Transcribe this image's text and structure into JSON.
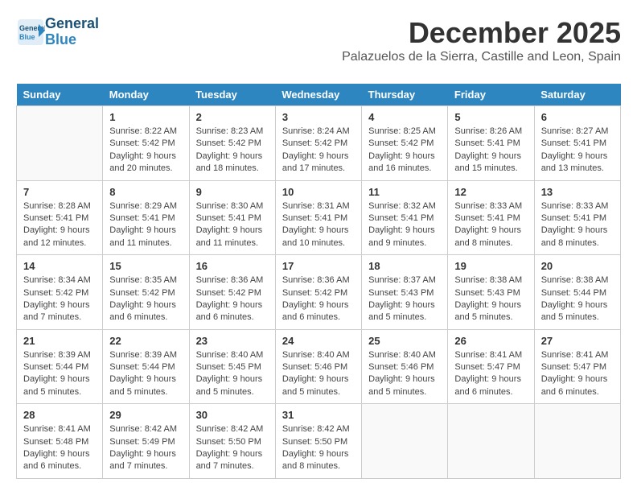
{
  "logo": {
    "line1": "General",
    "line2": "Blue"
  },
  "title": "December 2025",
  "location": "Palazuelos de la Sierra, Castille and Leon, Spain",
  "headers": [
    "Sunday",
    "Monday",
    "Tuesday",
    "Wednesday",
    "Thursday",
    "Friday",
    "Saturday"
  ],
  "weeks": [
    [
      {
        "day": "",
        "info": ""
      },
      {
        "day": "1",
        "info": "Sunrise: 8:22 AM\nSunset: 5:42 PM\nDaylight: 9 hours\nand 20 minutes."
      },
      {
        "day": "2",
        "info": "Sunrise: 8:23 AM\nSunset: 5:42 PM\nDaylight: 9 hours\nand 18 minutes."
      },
      {
        "day": "3",
        "info": "Sunrise: 8:24 AM\nSunset: 5:42 PM\nDaylight: 9 hours\nand 17 minutes."
      },
      {
        "day": "4",
        "info": "Sunrise: 8:25 AM\nSunset: 5:42 PM\nDaylight: 9 hours\nand 16 minutes."
      },
      {
        "day": "5",
        "info": "Sunrise: 8:26 AM\nSunset: 5:41 PM\nDaylight: 9 hours\nand 15 minutes."
      },
      {
        "day": "6",
        "info": "Sunrise: 8:27 AM\nSunset: 5:41 PM\nDaylight: 9 hours\nand 13 minutes."
      }
    ],
    [
      {
        "day": "7",
        "info": "Sunrise: 8:28 AM\nSunset: 5:41 PM\nDaylight: 9 hours\nand 12 minutes."
      },
      {
        "day": "8",
        "info": "Sunrise: 8:29 AM\nSunset: 5:41 PM\nDaylight: 9 hours\nand 11 minutes."
      },
      {
        "day": "9",
        "info": "Sunrise: 8:30 AM\nSunset: 5:41 PM\nDaylight: 9 hours\nand 11 minutes."
      },
      {
        "day": "10",
        "info": "Sunrise: 8:31 AM\nSunset: 5:41 PM\nDaylight: 9 hours\nand 10 minutes."
      },
      {
        "day": "11",
        "info": "Sunrise: 8:32 AM\nSunset: 5:41 PM\nDaylight: 9 hours\nand 9 minutes."
      },
      {
        "day": "12",
        "info": "Sunrise: 8:33 AM\nSunset: 5:41 PM\nDaylight: 9 hours\nand 8 minutes."
      },
      {
        "day": "13",
        "info": "Sunrise: 8:33 AM\nSunset: 5:41 PM\nDaylight: 9 hours\nand 8 minutes."
      }
    ],
    [
      {
        "day": "14",
        "info": "Sunrise: 8:34 AM\nSunset: 5:42 PM\nDaylight: 9 hours\nand 7 minutes."
      },
      {
        "day": "15",
        "info": "Sunrise: 8:35 AM\nSunset: 5:42 PM\nDaylight: 9 hours\nand 6 minutes."
      },
      {
        "day": "16",
        "info": "Sunrise: 8:36 AM\nSunset: 5:42 PM\nDaylight: 9 hours\nand 6 minutes."
      },
      {
        "day": "17",
        "info": "Sunrise: 8:36 AM\nSunset: 5:42 PM\nDaylight: 9 hours\nand 6 minutes."
      },
      {
        "day": "18",
        "info": "Sunrise: 8:37 AM\nSunset: 5:43 PM\nDaylight: 9 hours\nand 5 minutes."
      },
      {
        "day": "19",
        "info": "Sunrise: 8:38 AM\nSunset: 5:43 PM\nDaylight: 9 hours\nand 5 minutes."
      },
      {
        "day": "20",
        "info": "Sunrise: 8:38 AM\nSunset: 5:44 PM\nDaylight: 9 hours\nand 5 minutes."
      }
    ],
    [
      {
        "day": "21",
        "info": "Sunrise: 8:39 AM\nSunset: 5:44 PM\nDaylight: 9 hours\nand 5 minutes."
      },
      {
        "day": "22",
        "info": "Sunrise: 8:39 AM\nSunset: 5:44 PM\nDaylight: 9 hours\nand 5 minutes."
      },
      {
        "day": "23",
        "info": "Sunrise: 8:40 AM\nSunset: 5:45 PM\nDaylight: 9 hours\nand 5 minutes."
      },
      {
        "day": "24",
        "info": "Sunrise: 8:40 AM\nSunset: 5:46 PM\nDaylight: 9 hours\nand 5 minutes."
      },
      {
        "day": "25",
        "info": "Sunrise: 8:40 AM\nSunset: 5:46 PM\nDaylight: 9 hours\nand 5 minutes."
      },
      {
        "day": "26",
        "info": "Sunrise: 8:41 AM\nSunset: 5:47 PM\nDaylight: 9 hours\nand 6 minutes."
      },
      {
        "day": "27",
        "info": "Sunrise: 8:41 AM\nSunset: 5:47 PM\nDaylight: 9 hours\nand 6 minutes."
      }
    ],
    [
      {
        "day": "28",
        "info": "Sunrise: 8:41 AM\nSunset: 5:48 PM\nDaylight: 9 hours\nand 6 minutes."
      },
      {
        "day": "29",
        "info": "Sunrise: 8:42 AM\nSunset: 5:49 PM\nDaylight: 9 hours\nand 7 minutes."
      },
      {
        "day": "30",
        "info": "Sunrise: 8:42 AM\nSunset: 5:50 PM\nDaylight: 9 hours\nand 7 minutes."
      },
      {
        "day": "31",
        "info": "Sunrise: 8:42 AM\nSunset: 5:50 PM\nDaylight: 9 hours\nand 8 minutes."
      },
      {
        "day": "",
        "info": ""
      },
      {
        "day": "",
        "info": ""
      },
      {
        "day": "",
        "info": ""
      }
    ]
  ]
}
